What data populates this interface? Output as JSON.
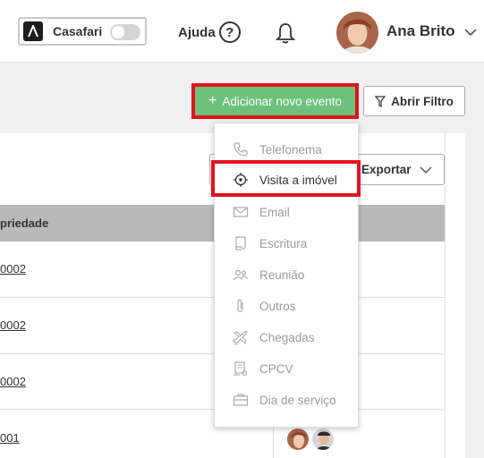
{
  "header": {
    "brand": "Casafari",
    "help_label": "Ajuda",
    "help_icon_glyph": "?",
    "user_name": "Ana Brito"
  },
  "actions": {
    "add_event_label": "Adicionar novo evento",
    "add_icon_glyph": "+",
    "filter_label": "Abrir Filtro",
    "export_label": "Exportar"
  },
  "table": {
    "column_header": "priedade",
    "rows": [
      {
        "property": "0002"
      },
      {
        "property": "0002"
      },
      {
        "property": "0002"
      },
      {
        "property": "001"
      }
    ]
  },
  "event_menu": {
    "items": [
      {
        "label": "Telefonema",
        "icon": "phone-icon"
      },
      {
        "label": "Visita a imóvel",
        "icon": "target-icon"
      },
      {
        "label": "Email",
        "icon": "envelope-icon"
      },
      {
        "label": "Escritura",
        "icon": "document-icon"
      },
      {
        "label": "Reunião",
        "icon": "people-icon"
      },
      {
        "label": "Outros",
        "icon": "paperclip-icon"
      },
      {
        "label": "Chegadas",
        "icon": "airplane-icon"
      },
      {
        "label": "CPCV",
        "icon": "contract-icon"
      },
      {
        "label": "Dia de serviço",
        "icon": "briefcase-icon"
      }
    ]
  },
  "colors": {
    "accent_green": "#6cc27a",
    "highlight_red": "#e3131d",
    "table_header": "#b9b9b9"
  }
}
